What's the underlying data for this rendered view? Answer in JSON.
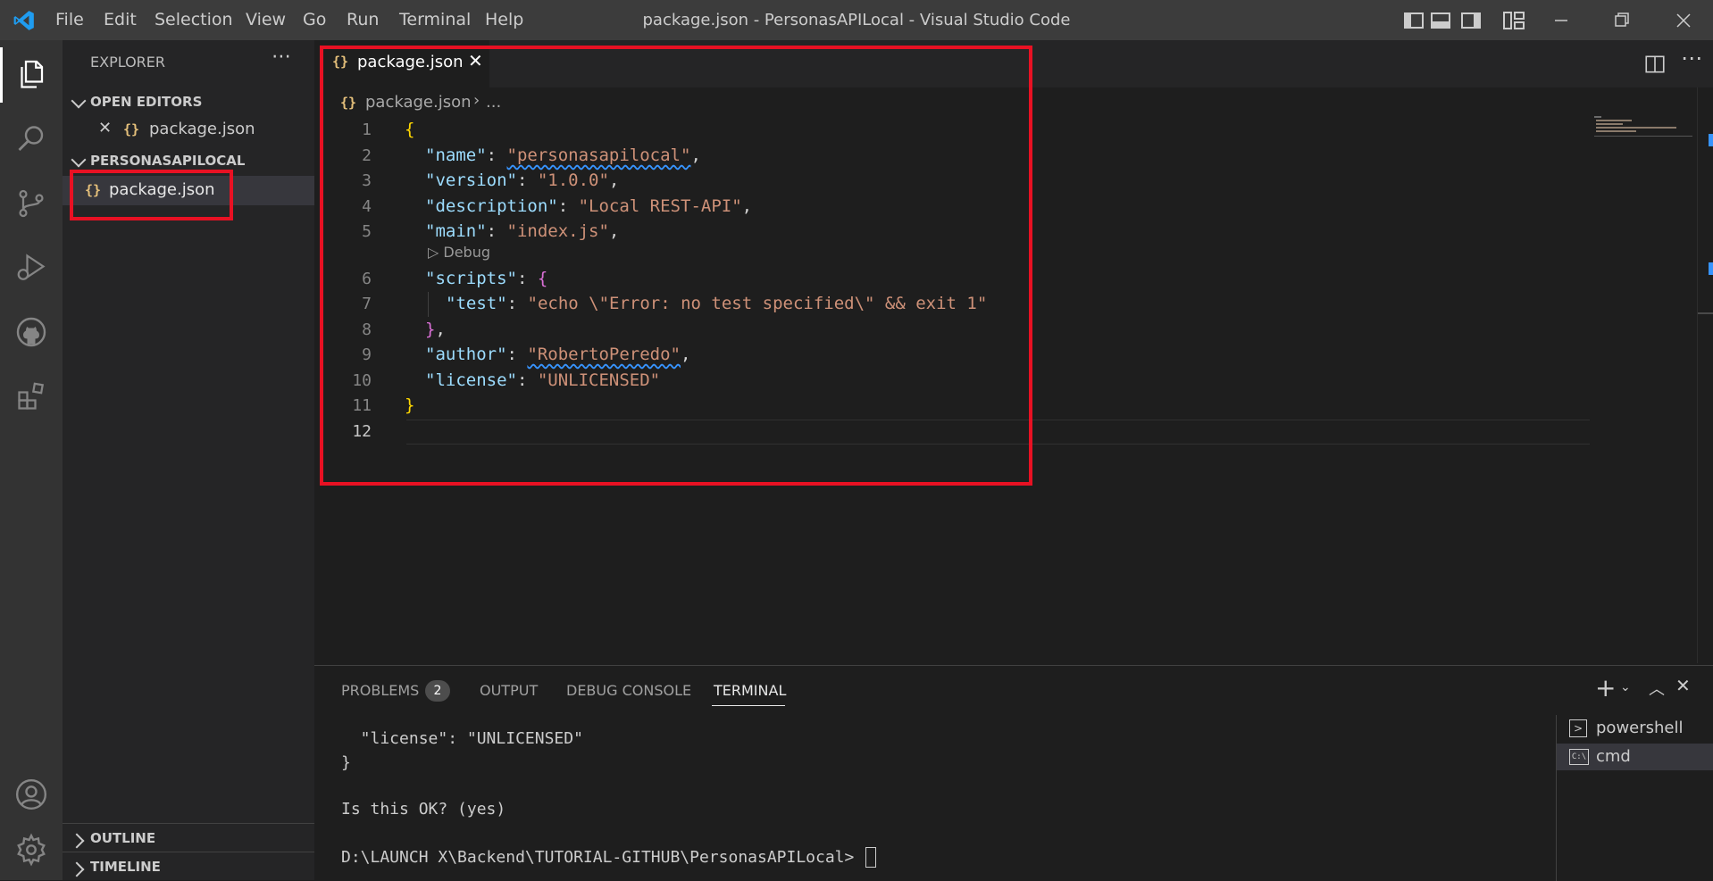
{
  "titlebar": {
    "title": "package.json - PersonasAPILocal - Visual Studio Code",
    "menu": [
      "File",
      "Edit",
      "Selection",
      "View",
      "Go",
      "Run",
      "Terminal",
      "Help"
    ]
  },
  "sidebar": {
    "title": "EXPLORER",
    "open_editors_label": "OPEN EDITORS",
    "open_editor_file": "package.json",
    "folder_label": "PERSONASAPILOCAL",
    "folder_file": "package.json",
    "outline_label": "OUTLINE",
    "timeline_label": "TIMELINE"
  },
  "editor": {
    "tab_label": "package.json",
    "breadcrumb_file": "package.json",
    "breadcrumb_more": "...",
    "codelens": "Debug",
    "line_numbers": [
      "1",
      "2",
      "3",
      "4",
      "5",
      "6",
      "7",
      "8",
      "9",
      "10",
      "11",
      "12"
    ],
    "json": {
      "name_key": "\"name\"",
      "name_val": "\"personasapilocal\"",
      "version_key": "\"version\"",
      "version_val": "\"1.0.0\"",
      "description_key": "\"description\"",
      "description_val": "\"Local REST-API\"",
      "main_key": "\"main\"",
      "main_val": "\"index.js\"",
      "scripts_key": "\"scripts\"",
      "test_key": "\"test\"",
      "test_val": "\"echo \\\"Error: no test specified\\\" && exit 1\"",
      "author_key": "\"author\"",
      "author_val": "\"RobertoPeredo\"",
      "license_key": "\"license\"",
      "license_val": "\"UNLICENSED\""
    }
  },
  "panel": {
    "tabs": [
      "PROBLEMS",
      "OUTPUT",
      "DEBUG CONSOLE",
      "TERMINAL"
    ],
    "problems_count": "2",
    "terminal_lines": [
      "  \"license\": \"UNLICENSED\"",
      "}",
      "",
      "",
      "Is this OK? (yes)",
      "",
      "D:\\LAUNCH X\\Backend\\TUTORIAL-GITHUB\\PersonasAPILocal>"
    ],
    "terminals": [
      "powershell",
      "cmd"
    ]
  },
  "colors": {
    "highlight_box": "#e81123",
    "accent": "#007acc"
  }
}
